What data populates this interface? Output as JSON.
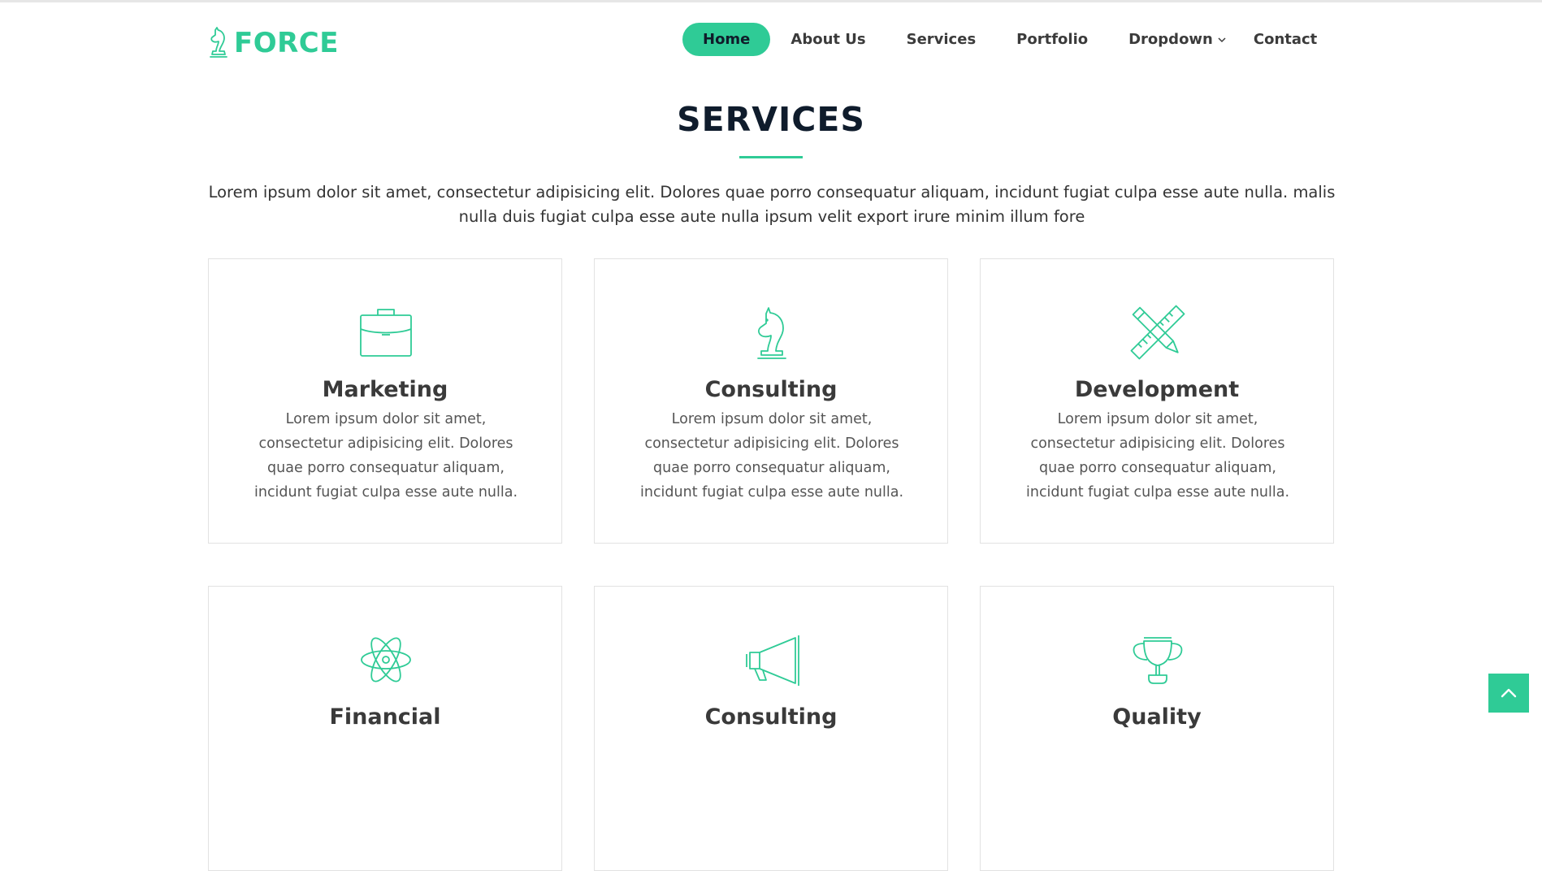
{
  "brand": {
    "name": "FORCE",
    "color": "#2fcb96",
    "icon": "knight-chess-icon"
  },
  "nav": {
    "items": [
      {
        "label": "Home",
        "active": true
      },
      {
        "label": "About Us"
      },
      {
        "label": "Services"
      },
      {
        "label": "Portfolio"
      },
      {
        "label": "Dropdown",
        "icon": "chevron-down-icon"
      },
      {
        "label": "Contact"
      }
    ]
  },
  "section": {
    "title": "SERVICES",
    "description": "Lorem ipsum dolor sit amet, consectetur adipisicing elit. Dolores quae porro consequatur aliquam, incidunt fugiat culpa esse aute nulla. malis nulla duis fugiat culpa esse aute nulla ipsum velit export irure minim illum fore"
  },
  "services": [
    {
      "icon": "briefcase-icon",
      "title": "Marketing",
      "text": "Lorem ipsum dolor sit amet, consectetur adipisicing elit. Dolores quae porro consequatur aliquam, incidunt fugiat culpa esse aute nulla."
    },
    {
      "icon": "knight-chess-icon",
      "title": "Consulting",
      "text": "Lorem ipsum dolor sit amet, consectetur adipisicing elit. Dolores quae porro consequatur aliquam, incidunt fugiat culpa esse aute nulla."
    },
    {
      "icon": "pencil-ruler-icon",
      "title": "Development",
      "text": "Lorem ipsum dolor sit amet, consectetur adipisicing elit. Dolores quae porro consequatur aliquam, incidunt fugiat culpa esse aute nulla."
    },
    {
      "icon": "atom-icon",
      "title": "Financial"
    },
    {
      "icon": "megaphone-icon",
      "title": "Consulting"
    },
    {
      "icon": "trophy-icon",
      "title": "Quality"
    }
  ],
  "scroll_top": {
    "icon": "chevron-up-icon"
  }
}
